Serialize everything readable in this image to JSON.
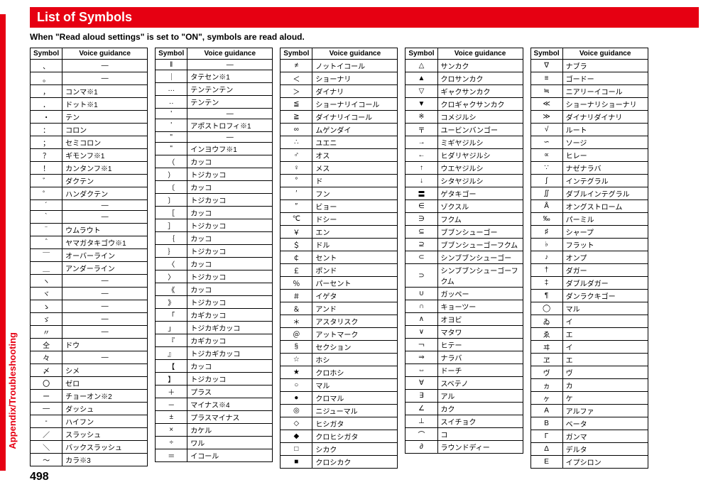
{
  "side_label": "Appendix/Troubleshooting",
  "page_number": "498",
  "title": "List of Symbols",
  "subtitle": "When \"Read aloud settings\" is set to \"ON\", symbols are read aloud.",
  "headers": {
    "symbol": "Symbol",
    "voice": "Voice guidance"
  },
  "tables": [
    [
      {
        "s": "、",
        "v": "—",
        "dash": true
      },
      {
        "s": "。",
        "v": "—",
        "dash": true
      },
      {
        "s": "，",
        "v": "コンマ※1"
      },
      {
        "s": "．",
        "v": "ドット※1"
      },
      {
        "s": "・",
        "v": "テン"
      },
      {
        "s": "：",
        "v": "コロン"
      },
      {
        "s": "；",
        "v": "セミコロン"
      },
      {
        "s": "？",
        "v": "ギモンフ※1"
      },
      {
        "s": "！",
        "v": "カンタンフ※1"
      },
      {
        "s": "゛",
        "v": "ダクテン"
      },
      {
        "s": "゜",
        "v": "ハンダクテン"
      },
      {
        "s": "´",
        "v": "—",
        "dash": true
      },
      {
        "s": "｀",
        "v": "—",
        "dash": true
      },
      {
        "s": "¨",
        "v": "ウムラウト"
      },
      {
        "s": "＾",
        "v": "ヤマガタキゴウ※1"
      },
      {
        "s": "￣",
        "v": "オーバーライン"
      },
      {
        "s": "＿",
        "v": "アンダーライン"
      },
      {
        "s": "ヽ",
        "v": "—",
        "dash": true
      },
      {
        "s": "ヾ",
        "v": "—",
        "dash": true
      },
      {
        "s": "ゝ",
        "v": "—",
        "dash": true
      },
      {
        "s": "ゞ",
        "v": "—",
        "dash": true
      },
      {
        "s": "〃",
        "v": "—",
        "dash": true
      },
      {
        "s": "仝",
        "v": "ドウ"
      },
      {
        "s": "々",
        "v": "—",
        "dash": true
      },
      {
        "s": "〆",
        "v": "シメ"
      },
      {
        "s": "〇",
        "v": "ゼロ"
      },
      {
        "s": "ー",
        "v": "チョーオン※2"
      },
      {
        "s": "―",
        "v": "ダッシュ"
      },
      {
        "s": "‐",
        "v": "ハイフン"
      },
      {
        "s": "／",
        "v": "スラッシュ"
      },
      {
        "s": "＼",
        "v": "バックスラッシュ"
      },
      {
        "s": "～",
        "v": "カラ※3"
      }
    ],
    [
      {
        "s": "‖",
        "v": "—",
        "dash": true
      },
      {
        "s": "｜",
        "v": "タテセン※1"
      },
      {
        "s": "…",
        "v": "テンテンテン"
      },
      {
        "s": "‥",
        "v": "テンテン"
      },
      {
        "s": "'",
        "v": "—",
        "dash": true
      },
      {
        "s": "'",
        "v": "アポストロフィ※1"
      },
      {
        "s": "\"",
        "v": "—",
        "dash": true
      },
      {
        "s": "\"",
        "v": "インヨウフ※1"
      },
      {
        "s": "（",
        "v": "カッコ"
      },
      {
        "s": "）",
        "v": "トジカッコ"
      },
      {
        "s": "〔",
        "v": "カッコ"
      },
      {
        "s": "〕",
        "v": "トジカッコ"
      },
      {
        "s": "［",
        "v": "カッコ"
      },
      {
        "s": "］",
        "v": "トジカッコ"
      },
      {
        "s": "｛",
        "v": "カッコ"
      },
      {
        "s": "｝",
        "v": "トジカッコ"
      },
      {
        "s": "〈",
        "v": "カッコ"
      },
      {
        "s": "〉",
        "v": "トジカッコ"
      },
      {
        "s": "《",
        "v": "カッコ"
      },
      {
        "s": "》",
        "v": "トジカッコ"
      },
      {
        "s": "「",
        "v": "カギカッコ"
      },
      {
        "s": "」",
        "v": "トジカギカッコ"
      },
      {
        "s": "『",
        "v": "カギカッコ"
      },
      {
        "s": "』",
        "v": "トジカギカッコ"
      },
      {
        "s": "【",
        "v": "カッコ"
      },
      {
        "s": "】",
        "v": "トジカッコ"
      },
      {
        "s": "＋",
        "v": "プラス"
      },
      {
        "s": "－",
        "v": "マイナス※4"
      },
      {
        "s": "±",
        "v": "プラスマイナス"
      },
      {
        "s": "×",
        "v": "カケル"
      },
      {
        "s": "÷",
        "v": "ワル"
      },
      {
        "s": "＝",
        "v": "イコール"
      }
    ],
    [
      {
        "s": "≠",
        "v": "ノットイコール"
      },
      {
        "s": "＜",
        "v": "ショーナリ"
      },
      {
        "s": "＞",
        "v": "ダイナリ"
      },
      {
        "s": "≦",
        "v": "ショーナリイコール"
      },
      {
        "s": "≧",
        "v": "ダイナリイコール"
      },
      {
        "s": "∞",
        "v": "ムゲンダイ"
      },
      {
        "s": "∴",
        "v": "ユエニ"
      },
      {
        "s": "♂",
        "v": "オス"
      },
      {
        "s": "♀",
        "v": "メス"
      },
      {
        "s": "°",
        "v": "ド"
      },
      {
        "s": "′",
        "v": "フン"
      },
      {
        "s": "″",
        "v": "ビョー"
      },
      {
        "s": "℃",
        "v": "ドシー"
      },
      {
        "s": "￥",
        "v": "エン"
      },
      {
        "s": "＄",
        "v": "ドル"
      },
      {
        "s": "￠",
        "v": "セント"
      },
      {
        "s": "￡",
        "v": "ポンド"
      },
      {
        "s": "％",
        "v": "パーセント"
      },
      {
        "s": "＃",
        "v": "イゲタ"
      },
      {
        "s": "＆",
        "v": "アンド"
      },
      {
        "s": "＊",
        "v": "アスタリスク"
      },
      {
        "s": "＠",
        "v": "アットマーク"
      },
      {
        "s": "§",
        "v": "セクション"
      },
      {
        "s": "☆",
        "v": "ホシ"
      },
      {
        "s": "★",
        "v": "クロホシ"
      },
      {
        "s": "○",
        "v": "マル"
      },
      {
        "s": "●",
        "v": "クロマル"
      },
      {
        "s": "◎",
        "v": "ニジューマル"
      },
      {
        "s": "◇",
        "v": "ヒシガタ"
      },
      {
        "s": "◆",
        "v": "クロヒシガタ"
      },
      {
        "s": "□",
        "v": "シカク"
      },
      {
        "s": "■",
        "v": "クロシカク"
      }
    ],
    [
      {
        "s": "△",
        "v": "サンカク"
      },
      {
        "s": "▲",
        "v": "クロサンカク"
      },
      {
        "s": "▽",
        "v": "ギャクサンカク"
      },
      {
        "s": "▼",
        "v": "クロギャクサンカク"
      },
      {
        "s": "※",
        "v": "コメジルシ"
      },
      {
        "s": "〒",
        "v": "ユービンバンゴー"
      },
      {
        "s": "→",
        "v": "ミギヤジルシ"
      },
      {
        "s": "←",
        "v": "ヒダリヤジルシ"
      },
      {
        "s": "↑",
        "v": "ウエヤジルシ"
      },
      {
        "s": "↓",
        "v": "シタヤジルシ"
      },
      {
        "s": "〓",
        "v": "ゲタキゴー"
      },
      {
        "s": "∈",
        "v": "ゾクスル"
      },
      {
        "s": "∋",
        "v": "フクム"
      },
      {
        "s": "⊆",
        "v": "ブブンシューゴー"
      },
      {
        "s": "⊇",
        "v": "ブブンシューゴーフクム"
      },
      {
        "s": "⊂",
        "v": "シンブブンシューゴー"
      },
      {
        "s": "⊃",
        "v": "シンブブンシューゴーフクム"
      },
      {
        "s": "∪",
        "v": "ガッペー"
      },
      {
        "s": "∩",
        "v": "キョーツー"
      },
      {
        "s": "∧",
        "v": "オヨビ"
      },
      {
        "s": "∨",
        "v": "マタワ"
      },
      {
        "s": "￢",
        "v": "ヒテー"
      },
      {
        "s": "⇒",
        "v": "ナラバ"
      },
      {
        "s": "⇔",
        "v": "ドーチ"
      },
      {
        "s": "∀",
        "v": "スベテノ"
      },
      {
        "s": "∃",
        "v": "アル"
      },
      {
        "s": "∠",
        "v": "カク"
      },
      {
        "s": "⊥",
        "v": "スイチョク"
      },
      {
        "s": "⌒",
        "v": "コ"
      },
      {
        "s": "∂",
        "v": "ラウンドディー"
      }
    ],
    [
      {
        "s": "∇",
        "v": "ナブラ"
      },
      {
        "s": "≡",
        "v": "ゴードー"
      },
      {
        "s": "≒",
        "v": "ニアリーイコール"
      },
      {
        "s": "≪",
        "v": "ショーナリショーナリ"
      },
      {
        "s": "≫",
        "v": "ダイナリダイナリ"
      },
      {
        "s": "√",
        "v": "ルート"
      },
      {
        "s": "∽",
        "v": "ソージ"
      },
      {
        "s": "∝",
        "v": "ヒレー"
      },
      {
        "s": "∵",
        "v": "ナゼナラバ"
      },
      {
        "s": "∫",
        "v": "インテグラル"
      },
      {
        "s": "∬",
        "v": "ダブルインテグラル"
      },
      {
        "s": "Å",
        "v": "オングストローム"
      },
      {
        "s": "‰",
        "v": "パーミル"
      },
      {
        "s": "♯",
        "v": "シャープ"
      },
      {
        "s": "♭",
        "v": "フラット"
      },
      {
        "s": "♪",
        "v": "オンプ"
      },
      {
        "s": "†",
        "v": "ダガー"
      },
      {
        "s": "‡",
        "v": "ダブルダガー"
      },
      {
        "s": "¶",
        "v": "ダンラクキゴー"
      },
      {
        "s": "◯",
        "v": "マル"
      },
      {
        "s": "ゐ",
        "v": "イ"
      },
      {
        "s": "ゑ",
        "v": "エ"
      },
      {
        "s": "ヰ",
        "v": "イ"
      },
      {
        "s": "ヱ",
        "v": "エ"
      },
      {
        "s": "ヴ",
        "v": "ヴ"
      },
      {
        "s": "ヵ",
        "v": "カ"
      },
      {
        "s": "ヶ",
        "v": "ケ"
      },
      {
        "s": "Α",
        "v": "アルファ"
      },
      {
        "s": "Β",
        "v": "ベータ"
      },
      {
        "s": "Γ",
        "v": "ガンマ"
      },
      {
        "s": "Δ",
        "v": "デルタ"
      },
      {
        "s": "Ε",
        "v": "イプシロン"
      }
    ]
  ]
}
